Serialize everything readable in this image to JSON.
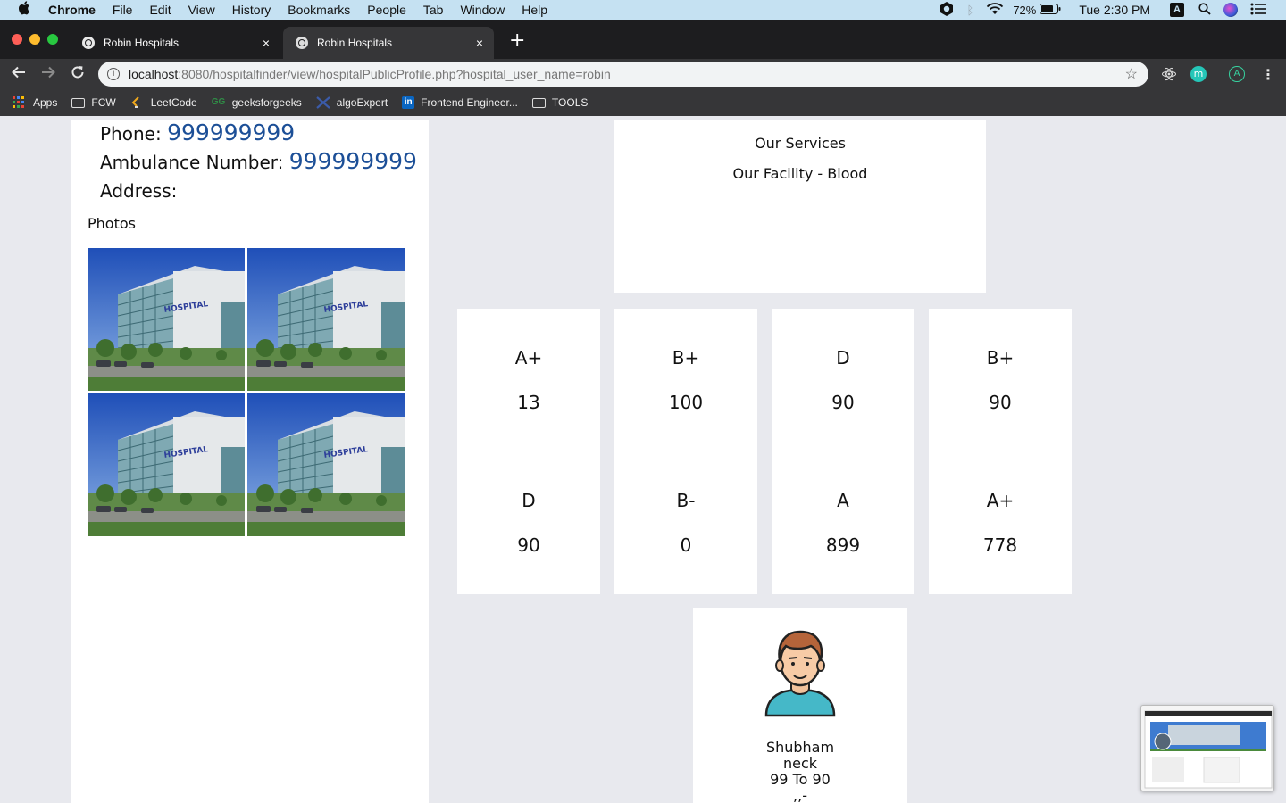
{
  "menubar": {
    "app": "Chrome",
    "items": [
      "File",
      "Edit",
      "View",
      "History",
      "Bookmarks",
      "People",
      "Tab",
      "Window",
      "Help"
    ],
    "battery": "72%",
    "clock": "Tue 2:30 PM",
    "input_source": "A"
  },
  "tabs": [
    {
      "title": "Robin Hospitals",
      "close": "×"
    },
    {
      "title": "Robin Hospitals",
      "close": "×"
    }
  ],
  "new_tab": "+",
  "omnibox": {
    "host": "localhost",
    "rest": ":8080/hospitalfinder/view/hospitalPublicProfile.php?hospital_user_name=robin"
  },
  "bookmarks": [
    {
      "label": "Apps",
      "icon": "apps-grid-icon"
    },
    {
      "label": "FCW",
      "icon": "folder-icon"
    },
    {
      "label": "LeetCode",
      "icon": "leetcode-icon"
    },
    {
      "label": "geeksforgeeks",
      "icon": "gfg-icon"
    },
    {
      "label": "algoExpert",
      "icon": "algoexpert-icon"
    },
    {
      "label": "Frontend Engineer...",
      "icon": "linkedin-icon"
    },
    {
      "label": "TOOLS",
      "icon": "folder-icon"
    }
  ],
  "hospital": {
    "phone_label": "Phone:",
    "phone": "999999999",
    "ambulance_label": "Ambulance Number:",
    "ambulance": "999999999",
    "address_label": "Address:",
    "photos_label": "Photos",
    "photo_sign": "HOSPITAL"
  },
  "services": {
    "heading": "Our Services",
    "facility": "Our Facility - Blood"
  },
  "blood_bank": [
    {
      "group": "A+",
      "count": "13"
    },
    {
      "group": "B+",
      "count": "100"
    },
    {
      "group": "D",
      "count": "90"
    },
    {
      "group": "B+",
      "count": "90"
    },
    {
      "group": "D",
      "count": "90"
    },
    {
      "group": "B-",
      "count": "0"
    },
    {
      "group": "A",
      "count": "899"
    },
    {
      "group": "A+",
      "count": "778"
    }
  ],
  "doctor": {
    "name": "Shubham",
    "specialty": "neck",
    "timing": "99 To 90",
    "extra": ",,-"
  },
  "colors": {
    "phone_value": "#1c4f97",
    "page_bg": "#e8e9ee",
    "menubar_bg": "#c5e1f2",
    "chrome_dark": "#363638"
  }
}
